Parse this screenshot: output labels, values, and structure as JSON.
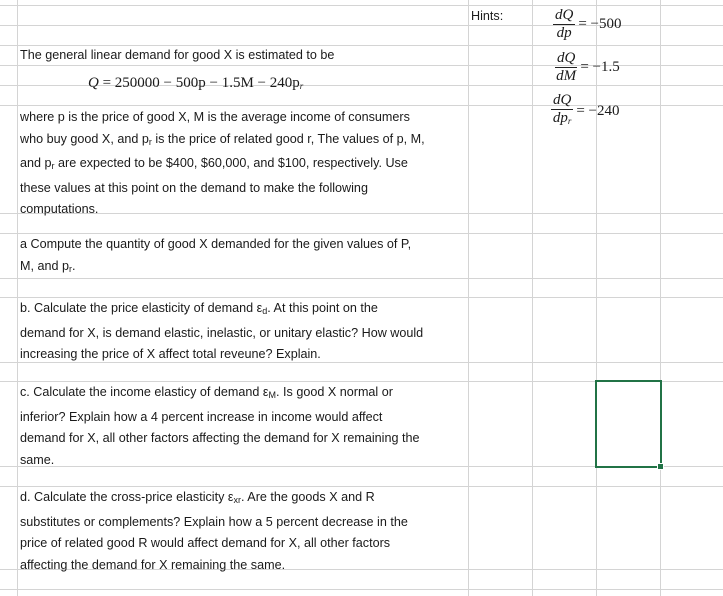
{
  "intro": {
    "line1": "The general linear demand for good X is estimated to be",
    "equation": {
      "lhs": "Q",
      "rhs": "= 250000 − 500p − 1.5M − 240p",
      "sub": "r"
    },
    "para": [
      "where p is the price of good X, M is the average income of consumers",
      "who buy good X, and p",
      "r",
      " is the price of related good r, The values of p, M,",
      "and p",
      "r",
      " are expected to be $400, $60,000, and $100, respectively. Use",
      "these values at this point on the demand to make the following",
      "computations."
    ]
  },
  "questions": {
    "a": [
      "a  Compute the quantity of good X demanded for the given values of P,",
      "M, and p",
      "r",
      "."
    ],
    "b": [
      "b.  Calculate the price elasticity of demand ε",
      "d",
      ". At this point on the",
      "demand for X, is demand elastic, inelastic, or unitary elastic? How would",
      "increasing the price of X affect total reveune? Explain."
    ],
    "c": [
      "c.  Calculate the income elasticy of demand ε",
      "M",
      ". Is good X normal or",
      "inferior? Explain how a 4 percent increase in income would affect",
      "demand for X, all other factors affecting the demand for X remaining the",
      "same."
    ],
    "d": [
      "d. Calculate the cross-price elasticity ε",
      "xr",
      ". Are the goods X and R",
      "substitutes or complements? Explain how a 5 percent decrease in the",
      "price of related good R would affect demand for X, all other factors",
      "affecting the demand for X remaining the same."
    ]
  },
  "hints": {
    "label": "Hints:",
    "items": [
      {
        "num": "dQ",
        "den": "dp",
        "den_sub": "",
        "value": "= −500"
      },
      {
        "num": "dQ",
        "den": "dM",
        "den_sub": "",
        "value": "= −1.5"
      },
      {
        "num": "dQ",
        "den": "dp",
        "den_sub": "r",
        "value": "= −240"
      }
    ]
  },
  "colors": {
    "selection": "#217346",
    "gridline": "#d4d4d4"
  }
}
